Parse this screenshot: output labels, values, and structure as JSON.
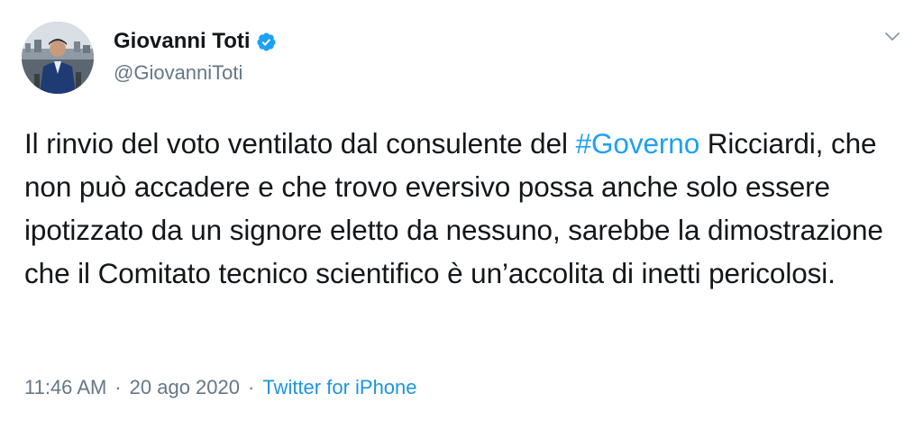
{
  "author": {
    "display_name": "Giovanni Toti",
    "handle": "@GiovanniToti",
    "verified": true
  },
  "tweet": {
    "text_before": "Il rinvio del voto ventilato dal consulente del ",
    "hashtag": "#Governo",
    "text_after": " Ricciardi, che non può accadere e che trovo eversivo possa anche solo essere ipotizzato da un signore eletto da nessuno, sarebbe la dimostrazione che il Comitato tecnico scientifico è un’accolita di inetti pericolosi."
  },
  "meta": {
    "time": "11:46 AM",
    "separator": "·",
    "date": "20 ago 2020",
    "source": "Twitter for iPhone"
  },
  "icons": {
    "verified": "verified-badge-icon",
    "menu": "chevron-down-icon"
  },
  "colors": {
    "link": "#1da1f2",
    "secondary": "#657786",
    "primary_text": "#14171a"
  }
}
